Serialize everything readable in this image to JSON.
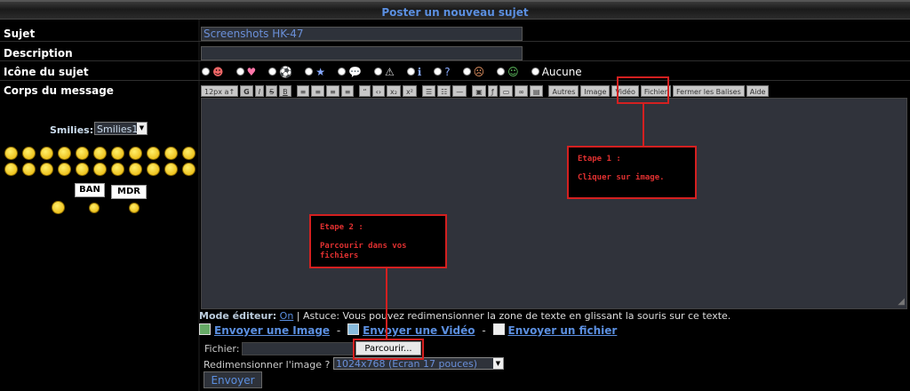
{
  "header": {
    "title": "Poster un nouveau sujet"
  },
  "fields": {
    "subject_label": "Sujet",
    "subject_value": "Screenshots HK-47",
    "description_label": "Description",
    "description_value": "",
    "icon_label": "Icône du sujet",
    "icon_none_label": "Aucune",
    "body_label": "Corps du message"
  },
  "topic_icons": [
    "smile-icon",
    "heart-icon",
    "soccer-icon",
    "star-icon",
    "speech-icon",
    "warning-icon",
    "info-icon",
    "question-icon",
    "face-icon",
    "laugh-icon"
  ],
  "smilies": {
    "label": "Smilies:",
    "selected": "Smilies1",
    "signs": [
      "BAN",
      "MDR"
    ]
  },
  "toolbar": {
    "font_size": "12px",
    "bold": "G",
    "italic": "I",
    "strike": "S",
    "underline": "B",
    "autres": "Autres",
    "image": "Image",
    "video": "Vidéo",
    "fichier": "Fichier",
    "close_tags": "Fermer les Balises",
    "aide": "Aide"
  },
  "editor_mode": {
    "label": "Mode éditeur:",
    "value": "On",
    "tip": "| Astuce: Vous pouvez redimensionner la zone de texte en glissant la souris sur ce texte."
  },
  "send_links": {
    "image": "Envoyer une Image",
    "video": "Envoyer une Vidéo",
    "file": "Envoyer un fichier",
    "sep": "-"
  },
  "upload": {
    "file_label": "Fichier:",
    "browse_label": "Parcourir...",
    "resize_label": "Redimensionner l'image ?",
    "resize_value": "1024x768 (Ecran 17 pouces)",
    "submit_label": "Envoyer"
  },
  "annotations": {
    "step1_title": "Etape 1 :",
    "step1_text": "Cliquer sur image.",
    "step2_title": "Etape 2 :",
    "step2_text": "Parcourir dans vos\nfichiers",
    "color": "#d42020"
  },
  "colors": {
    "link": "#5b8fe0",
    "field_bg": "#2e323a"
  }
}
